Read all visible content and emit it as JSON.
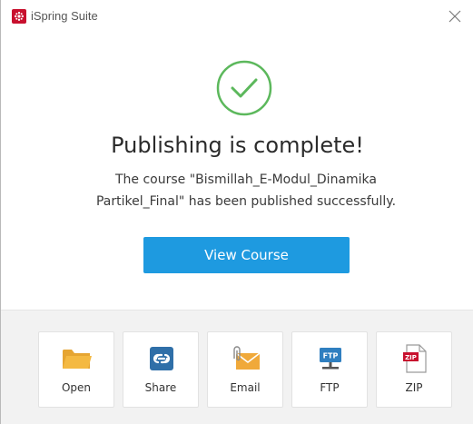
{
  "window": {
    "title": "iSpring Suite",
    "close_icon": "close-icon"
  },
  "status": {
    "icon": "checkmark-circle-icon",
    "heading": "Publishing is complete!",
    "message_line1": "The course \"Bismillah_E-Modul_Dinamika",
    "message_line2": "Partikel_Final\" has been published successfully."
  },
  "primary_action": {
    "label": "View Course"
  },
  "actions": [
    {
      "label": "Open",
      "icon": "folder-icon"
    },
    {
      "label": "Share",
      "icon": "share-link-icon"
    },
    {
      "label": "Email",
      "icon": "email-icon"
    },
    {
      "label": "FTP",
      "icon": "ftp-icon"
    },
    {
      "label": "ZIP",
      "icon": "zip-icon"
    }
  ],
  "colors": {
    "accent": "#1e9ae0",
    "success": "#5cb85c",
    "brand": "#c8102e",
    "footer_bg": "#f2f2f2"
  }
}
